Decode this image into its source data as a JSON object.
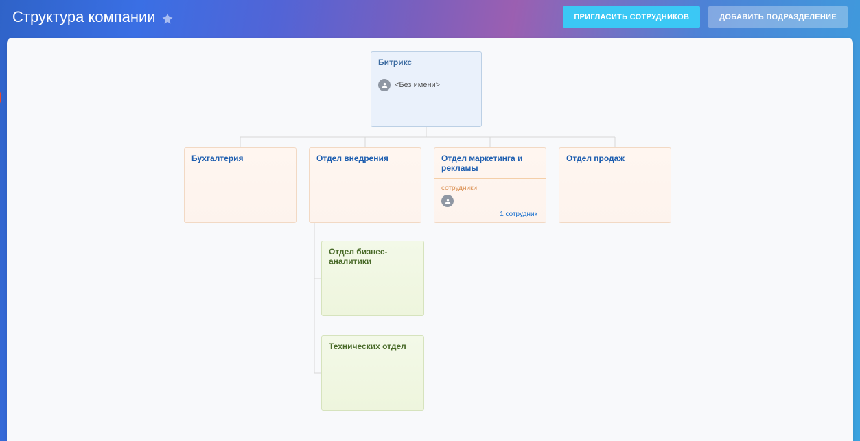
{
  "page_title": "Структура компании",
  "header": {
    "invite_btn": "ПРИГЛАСИТЬ СОТРУДНИКОВ",
    "add_dept_btn": "ДОБАВИТЬ ПОДРАЗДЕЛЕНИЕ"
  },
  "org": {
    "root": {
      "name": "Битрикс",
      "head_name": "<Без имени>"
    },
    "depts": [
      {
        "name": "Бухгалтерия"
      },
      {
        "name": "Отдел внедрения",
        "subs": [
          {
            "name": "Отдел бизнес-аналитики"
          },
          {
            "name": "Технических отдел"
          }
        ]
      },
      {
        "name": "Отдел маркетинга и рекламы",
        "employees_label": "сотрудники",
        "employee_count_link": "1 сотрудник"
      },
      {
        "name": "Отдел продаж"
      }
    ]
  }
}
